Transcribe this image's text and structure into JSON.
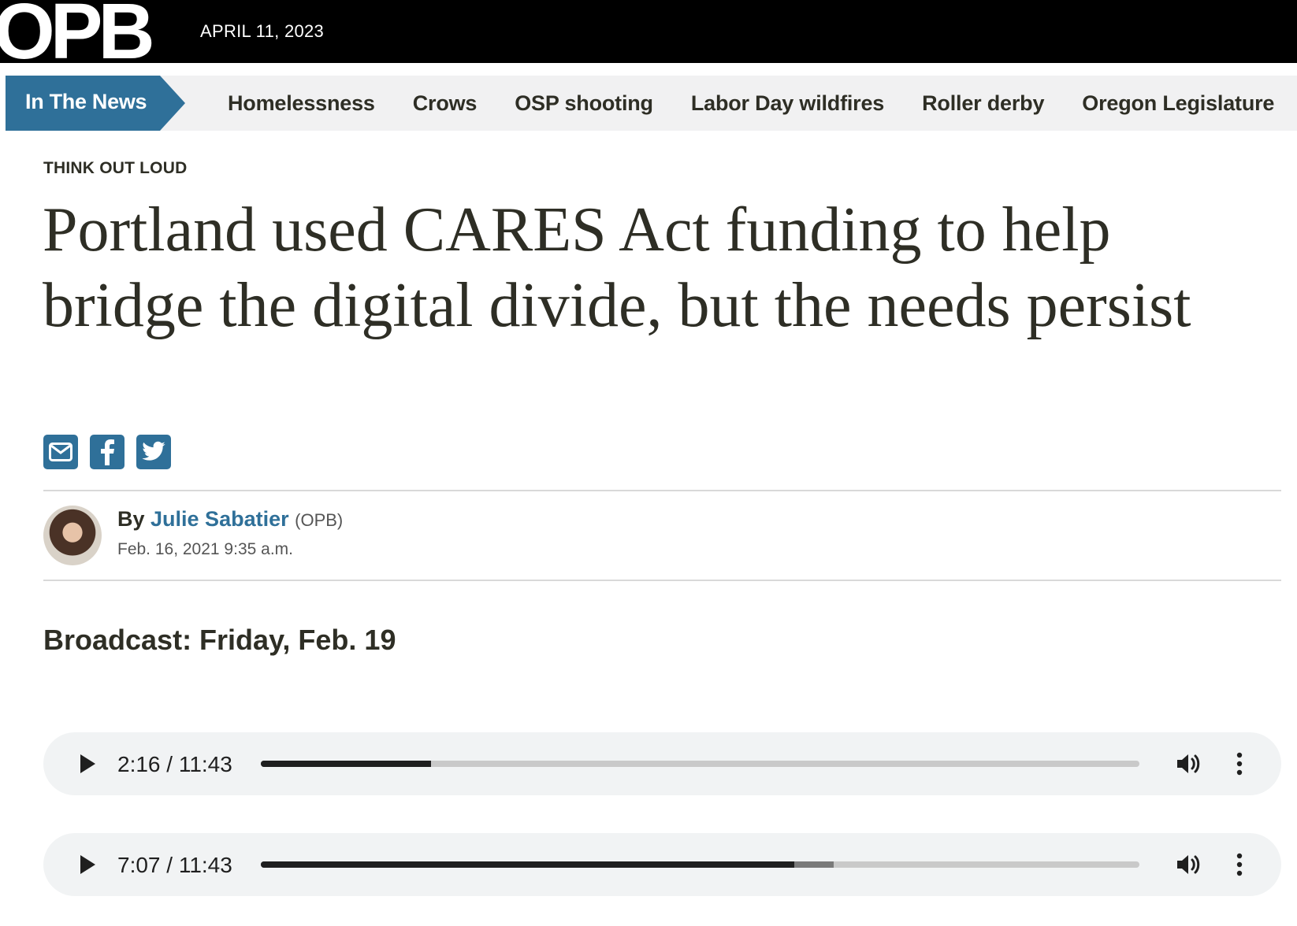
{
  "header": {
    "logo_text": "OPB",
    "date": "APRIL 11, 2023"
  },
  "news_nav": {
    "label": "In The News",
    "links": [
      "Homelessness",
      "Crows",
      "OSP shooting",
      "Labor Day wildfires",
      "Roller derby",
      "Oregon Legislature"
    ]
  },
  "article": {
    "kicker": "THINK OUT LOUD",
    "headline": "Portland used CARES Act funding to help bridge the digital divide, but the needs persist",
    "share_icons": [
      "email-icon",
      "facebook-icon",
      "twitter-icon"
    ],
    "byline": {
      "prefix": "By",
      "author": "Julie Sabatier",
      "org": "(OPB)",
      "date": "Feb. 16, 2021 9:35 a.m."
    },
    "broadcast": "Broadcast: Friday, Feb. 19"
  },
  "audio_players": [
    {
      "time": "2:16 / 11:43",
      "progress_percent": 19.4,
      "buffered_percent": 19.4
    },
    {
      "time": "7:07 / 11:43",
      "progress_percent": 60.7,
      "buffered_percent": 65.2
    }
  ],
  "colors": {
    "accent": "#2f7099",
    "text": "#2e2e25",
    "nav_bg": "#f1f1f2",
    "topbar_bg": "#000000",
    "player_bg": "#f1f3f4"
  }
}
